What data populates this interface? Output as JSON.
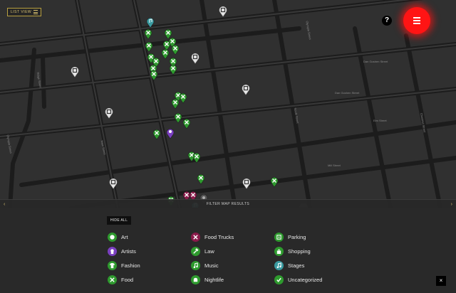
{
  "header": {
    "list_view_label": "LIST VIEW",
    "help_label": "?"
  },
  "filter_bar": {
    "title": "FILTER MAP RESULTS",
    "left_arrow": "‹",
    "right_arrow": "›"
  },
  "panel": {
    "hide_all_label": "HIDE ALL",
    "close_label": "×",
    "categories": [
      {
        "label": "Art",
        "color": "#2e9a2e",
        "icon": "palette-icon"
      },
      {
        "label": "Artists",
        "color": "#7a3fc0",
        "icon": "artist-icon"
      },
      {
        "label": "Fashion",
        "color": "#2e9a2e",
        "icon": "shirt-icon"
      },
      {
        "label": "Food",
        "color": "#2e9a2e",
        "icon": "utensils-icon"
      },
      {
        "label": "Food Trucks",
        "color": "#8a1a4a",
        "icon": "food-truck-icon"
      },
      {
        "label": "Law",
        "color": "#2e9a2e",
        "icon": "gavel-icon"
      },
      {
        "label": "Music",
        "color": "#2e9a2e",
        "icon": "music-icon"
      },
      {
        "label": "Nightlife",
        "color": "#2e9a2e",
        "icon": "cocktail-icon"
      },
      {
        "label": "Parking",
        "color": "#2e9a2e",
        "icon": "parking-icon"
      },
      {
        "label": "Shopping",
        "color": "#2e9a2e",
        "icon": "shopping-bag-icon"
      },
      {
        "label": "Stages",
        "color": "#3a9aa0",
        "icon": "stage-icon"
      },
      {
        "label": "Uncategorized",
        "color": "#2e9a2e",
        "icon": "check-icon"
      }
    ]
  },
  "map": {
    "street_labels": [
      "Dan Goshen Street",
      "Dan Goshen Street",
      "Elm Street",
      "Mill Street",
      "Ridge Street",
      "Main Street",
      "South Street",
      "Chestnut Street",
      "Olympia Street",
      "Olympia Street"
    ]
  }
}
